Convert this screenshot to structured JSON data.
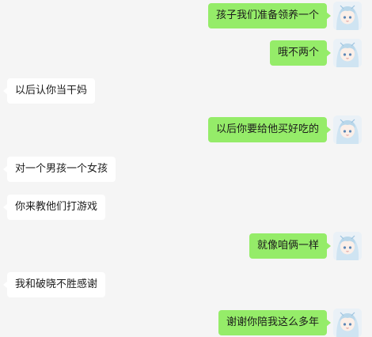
{
  "chat": {
    "messages": [
      {
        "side": "me",
        "text": "孩子我们准备领养一个"
      },
      {
        "side": "me",
        "text": "哦不两个"
      },
      {
        "side": "other",
        "text": "以后认你当干妈"
      },
      {
        "side": "me",
        "text": "以后你要给他买好吃的"
      },
      {
        "side": "other",
        "text": "对一个男孩一个女孩"
      },
      {
        "side": "other",
        "text": "你来教他们打游戏"
      },
      {
        "side": "me",
        "text": "就像咱俩一样"
      },
      {
        "side": "other",
        "text": "我和破晓不胜感谢"
      },
      {
        "side": "me",
        "text": "谢谢你陪我这么多年"
      }
    ]
  },
  "colors": {
    "background": "#f5f5f5",
    "my_bubble": "#95ec69",
    "other_bubble": "#ffffff"
  },
  "icons": {
    "my_avatar": "anime-girl-avatar-icon"
  }
}
